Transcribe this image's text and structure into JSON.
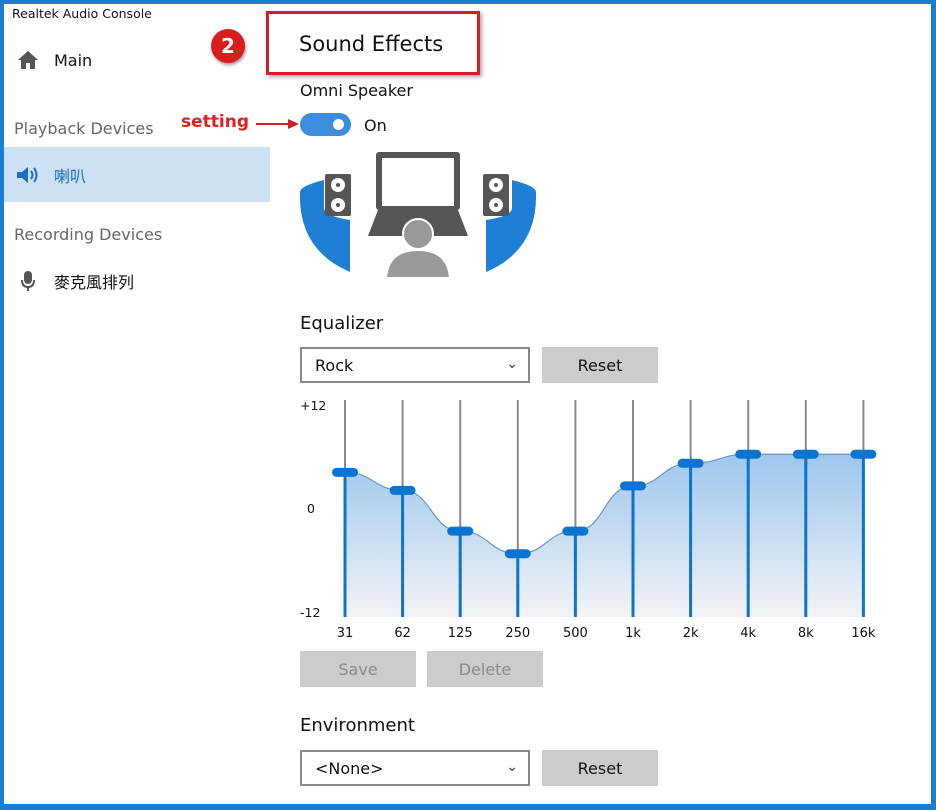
{
  "app_title": "Realtek Audio Console",
  "sidebar": {
    "main": "Main",
    "playback_header": "Playback Devices",
    "playback_items": [
      {
        "label": "喇叭",
        "icon": "speaker-icon",
        "selected": true
      }
    ],
    "recording_header": "Recording Devices",
    "recording_items": [
      {
        "label": "麥克風排列",
        "icon": "microphone-icon"
      }
    ]
  },
  "annotation": {
    "badge": "2",
    "arrow_label": "setting",
    "highlight_color": "#d01f25"
  },
  "page": {
    "title": "Sound Effects",
    "omni_label": "Omni Speaker",
    "omni_state": "On",
    "omni_enabled": true
  },
  "equalizer": {
    "label": "Equalizer",
    "preset": "Rock",
    "reset": "Reset",
    "save": "Save",
    "delete": "Delete"
  },
  "environment": {
    "label": "Environment",
    "value": "<None>",
    "reset": "Reset"
  },
  "accent_color": "#0a74d0",
  "chart_data": {
    "type": "area",
    "ylim": [
      -12,
      12
    ],
    "ytick_labels": [
      "+12",
      "0",
      "-12"
    ],
    "categories": [
      "31",
      "62",
      "125",
      "250",
      "500",
      "1k",
      "2k",
      "4k",
      "8k",
      "16k"
    ],
    "values": [
      4,
      2,
      -2.5,
      -5,
      -2.5,
      2.5,
      5,
      6,
      6,
      6
    ]
  }
}
